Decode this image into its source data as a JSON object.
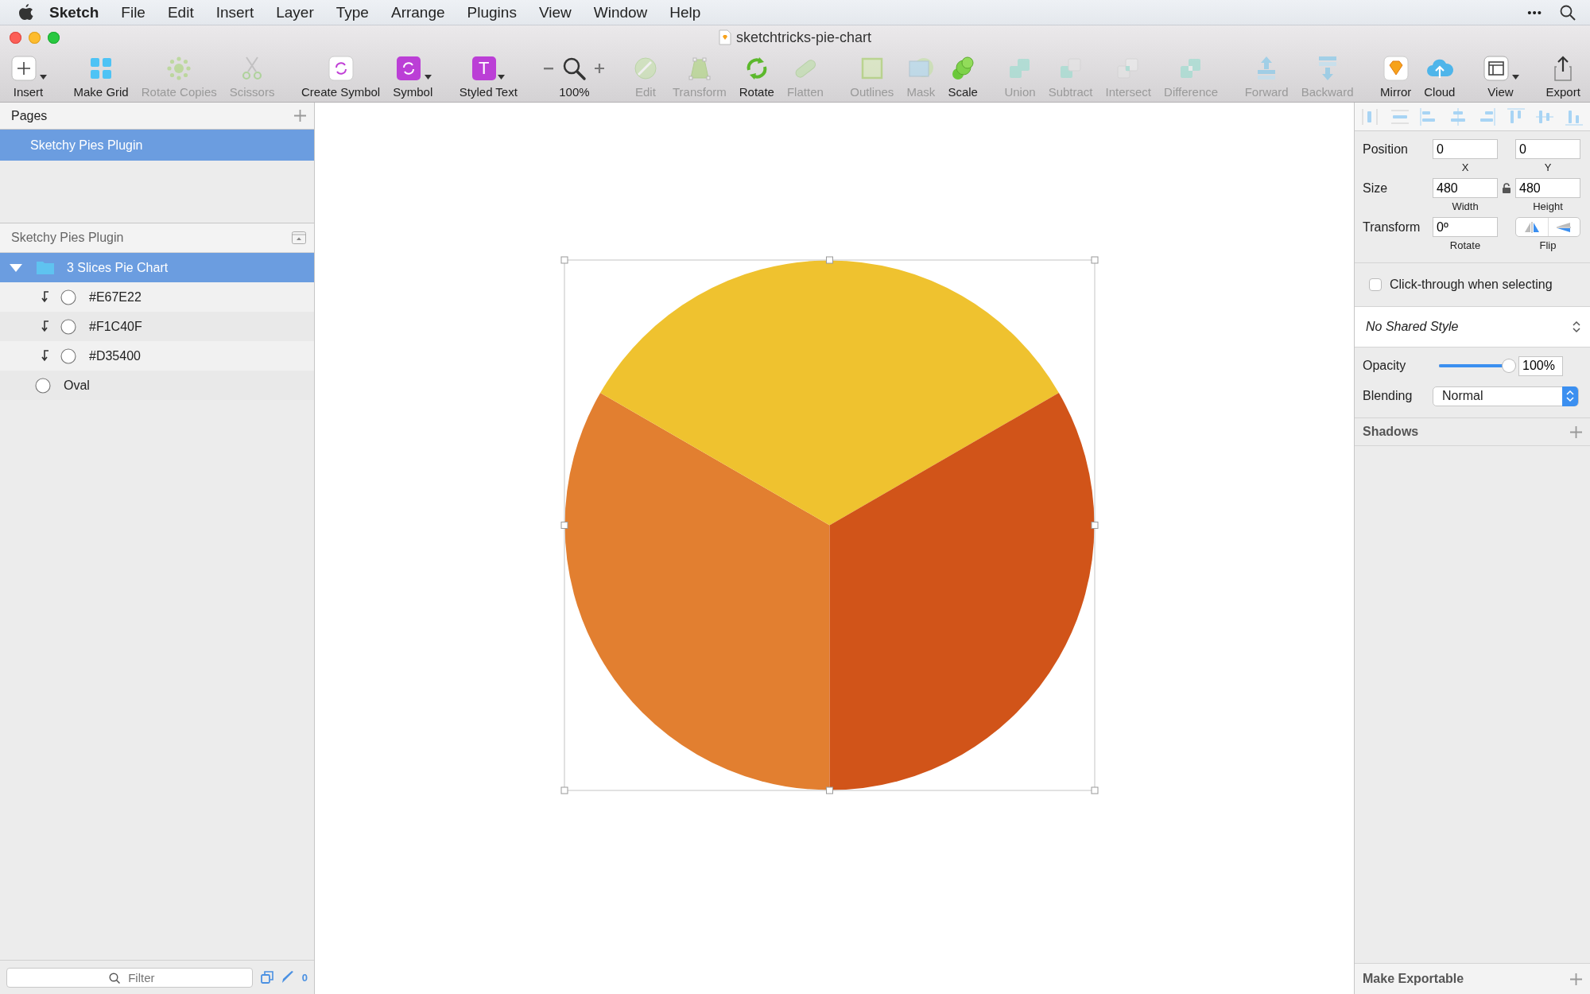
{
  "menubar": {
    "app": "Sketch",
    "menus": [
      "File",
      "Edit",
      "Insert",
      "Layer",
      "Type",
      "Arrange",
      "Plugins",
      "View",
      "Window",
      "Help"
    ],
    "more": "•••"
  },
  "window": {
    "title": "sketchtricks-pie-chart"
  },
  "toolbar": {
    "groups": [
      {
        "items": [
          {
            "kind": "insert",
            "label": "Insert",
            "disabled": false,
            "dropdown": true
          }
        ]
      },
      {
        "items": [
          {
            "kind": "grid",
            "label": "Make Grid",
            "disabled": false,
            "dropdown": false
          },
          {
            "kind": "rotate-copies",
            "label": "Rotate Copies",
            "disabled": true,
            "dropdown": false
          },
          {
            "kind": "scissors",
            "label": "Scissors",
            "disabled": true,
            "dropdown": false
          }
        ]
      },
      {
        "items": [
          {
            "kind": "create-symbol",
            "label": "Create Symbol",
            "disabled": false,
            "dropdown": false
          },
          {
            "kind": "symbol",
            "label": "Symbol",
            "disabled": false,
            "dropdown": true
          }
        ]
      },
      {
        "items": [
          {
            "kind": "styled-text",
            "label": "Styled Text",
            "glyph": "T",
            "disabled": false,
            "dropdown": true
          }
        ]
      },
      {
        "items": [
          {
            "kind": "zoom",
            "label": "100%",
            "disabled": false,
            "dropdown": false
          }
        ]
      },
      {
        "items": [
          {
            "kind": "edit",
            "label": "Edit",
            "disabled": true,
            "dropdown": false
          },
          {
            "kind": "transform",
            "label": "Transform",
            "disabled": true,
            "dropdown": false
          },
          {
            "kind": "rotate",
            "label": "Rotate",
            "disabled": false,
            "dropdown": false
          },
          {
            "kind": "flatten",
            "label": "Flatten",
            "disabled": true,
            "dropdown": false
          }
        ]
      },
      {
        "items": [
          {
            "kind": "outlines",
            "label": "Outlines",
            "disabled": true,
            "dropdown": false
          },
          {
            "kind": "mask",
            "label": "Mask",
            "disabled": true,
            "dropdown": false
          },
          {
            "kind": "scale",
            "label": "Scale",
            "disabled": false,
            "dropdown": false
          }
        ]
      },
      {
        "items": [
          {
            "kind": "union",
            "label": "Union",
            "disabled": true,
            "dropdown": false
          },
          {
            "kind": "subtract",
            "label": "Subtract",
            "disabled": true,
            "dropdown": false
          },
          {
            "kind": "intersect",
            "label": "Intersect",
            "disabled": true,
            "dropdown": false
          },
          {
            "kind": "difference",
            "label": "Difference",
            "disabled": true,
            "dropdown": false
          }
        ]
      },
      {
        "items": [
          {
            "kind": "forward",
            "label": "Forward",
            "disabled": true,
            "dropdown": false
          },
          {
            "kind": "backward",
            "label": "Backward",
            "disabled": true,
            "dropdown": false
          }
        ]
      },
      {
        "items": [
          {
            "kind": "mirror",
            "label": "Mirror",
            "disabled": false,
            "dropdown": false
          },
          {
            "kind": "cloud",
            "label": "Cloud",
            "disabled": false,
            "dropdown": false
          }
        ]
      },
      {
        "items": [
          {
            "kind": "view",
            "label": "View",
            "disabled": false,
            "dropdown": true
          }
        ]
      },
      {
        "items": [
          {
            "kind": "export",
            "label": "Export",
            "disabled": false,
            "dropdown": false
          }
        ]
      }
    ]
  },
  "pages": {
    "title": "Pages",
    "items": [
      {
        "label": "Sketchy Pies Plugin",
        "selected": true
      }
    ]
  },
  "layers": {
    "title": "Sketchy Pies Plugin",
    "items": [
      {
        "name": "3 Slices Pie Chart",
        "kind": "group",
        "expanded": true,
        "selected": true,
        "children": [
          {
            "name": "#E67E22",
            "kind": "oval",
            "clipped": true,
            "selected": false
          },
          {
            "name": "#F1C40F",
            "kind": "oval",
            "clipped": true,
            "selected": false
          },
          {
            "name": "#D35400",
            "kind": "oval",
            "clipped": true,
            "selected": false
          },
          {
            "name": "Oval",
            "kind": "oval",
            "clipped": false,
            "selected": false
          }
        ]
      }
    ]
  },
  "filter": {
    "placeholder": "Filter",
    "count": "0"
  },
  "canvas": {
    "selected": true,
    "slices": [
      {
        "color": "#e27f30"
      },
      {
        "color": "#efc22f"
      },
      {
        "color": "#d15419"
      }
    ]
  },
  "inspector": {
    "rows": [
      {
        "label": "Position",
        "locked": null,
        "fields": [
          {
            "value": "0",
            "caption": "X"
          },
          {
            "value": "0",
            "caption": "Y"
          }
        ]
      },
      {
        "label": "Size",
        "locked": false,
        "fields": [
          {
            "value": "480",
            "caption": "Width"
          },
          {
            "value": "480",
            "caption": "Height"
          }
        ]
      }
    ],
    "transform": {
      "label": "Transform",
      "value": "0º",
      "caption": "Rotate",
      "flip_caption": "Flip"
    },
    "click_through": {
      "label": "Click-through when selecting",
      "checked": false
    },
    "shared_style": "No Shared Style",
    "opacity": {
      "label": "Opacity",
      "level": 1,
      "value": "100%"
    },
    "blending": {
      "label": "Blending",
      "value": "Normal"
    },
    "shadows": "Shadows",
    "exportable": "Make Exportable"
  }
}
